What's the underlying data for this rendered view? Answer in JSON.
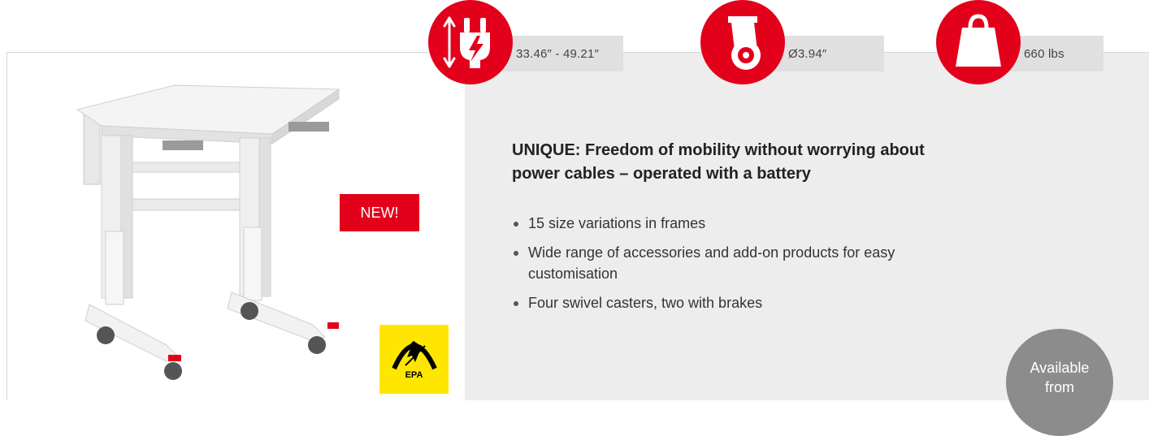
{
  "specs": [
    {
      "icon": "height-power-icon",
      "label": "33.46″ - 49.21″"
    },
    {
      "icon": "caster-wheel-icon",
      "label": "Ø3.94″"
    },
    {
      "icon": "weight-icon",
      "label": "660 lbs"
    }
  ],
  "badges": {
    "new": "NEW!",
    "epa": "EPA"
  },
  "product": {
    "headline": "UNIQUE: Freedom of mobility without worrying about power cables – operated with a battery",
    "features": [
      "15 size variations in frames",
      "Wide range of accessories and add-on products for easy customisation",
      "Four swivel casters, two with brakes"
    ]
  },
  "availability": {
    "line1": "Available",
    "line2": "from"
  },
  "colors": {
    "accent": "#e3001b",
    "panel_bg": "#ededed",
    "label_bg": "#e0e0e0",
    "availability_bg": "#8c8c8c",
    "epa_yellow": "#ffe600"
  }
}
